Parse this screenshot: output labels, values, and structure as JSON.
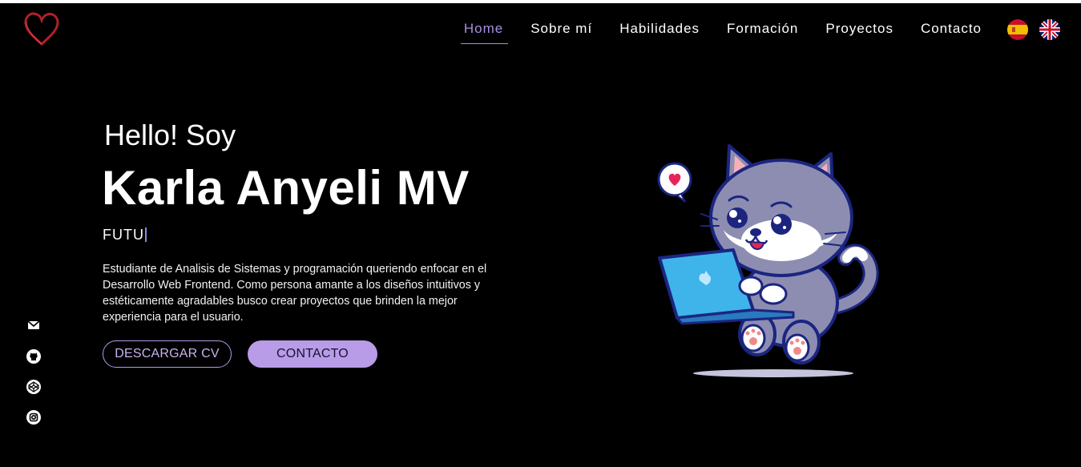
{
  "nav": {
    "items": [
      {
        "label": "Home",
        "active": true
      },
      {
        "label": "Sobre mí",
        "active": false
      },
      {
        "label": "Habilidades",
        "active": false
      },
      {
        "label": "Formación",
        "active": false
      },
      {
        "label": "Proyectos",
        "active": false
      },
      {
        "label": "Contacto",
        "active": false
      }
    ],
    "languages": [
      "spain-flag-icon",
      "uk-flag-icon"
    ]
  },
  "hero": {
    "greeting": "Hello! Soy",
    "name": "Karla Anyeli MV",
    "typed_text": "FUTU",
    "description": "Estudiante de Analisis de Sistemas y programación queriendo enfocar en el Desarrollo Web Frontend. Como persona amante a los diseños intuitivos y estéticamente agradables busco crear proyectos que brinden la mejor experiencia para el usuario.",
    "buttons": {
      "cv": "DESCARGAR CV",
      "contact": "CONTACTO"
    }
  },
  "social": [
    "mail-icon",
    "github-icon",
    "codepen-icon",
    "instagram-icon"
  ],
  "colors": {
    "background": "#000000",
    "accent": "#b89ce8",
    "logo_heart": "#b0202a"
  },
  "illustration": "cat-with-laptop"
}
